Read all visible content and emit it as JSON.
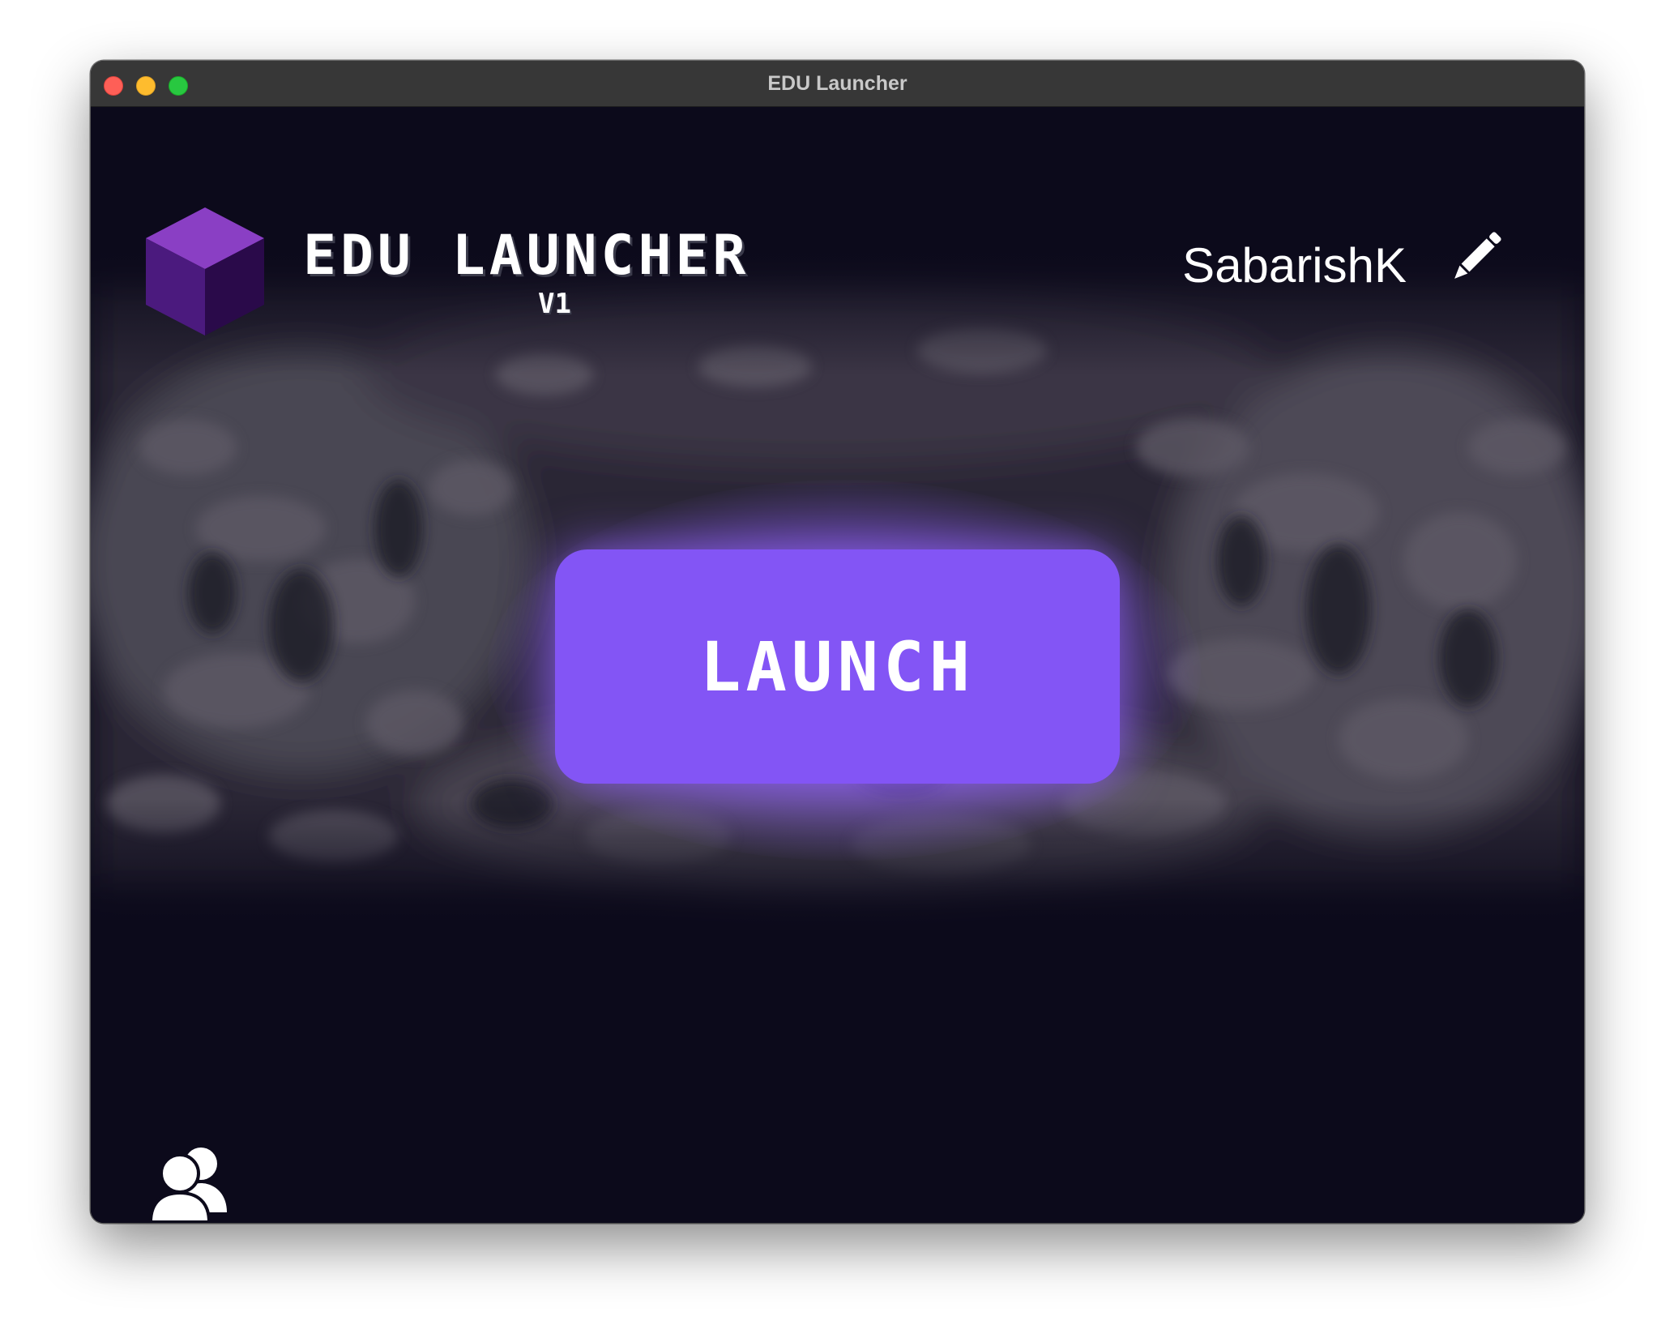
{
  "window": {
    "title": "EDU Launcher"
  },
  "brand": {
    "title": "EDU LAUNCHER",
    "version": "V1",
    "logo_icon": "purple-cube-icon",
    "accent_color": "#8355f5"
  },
  "user": {
    "name": "SabarishK",
    "edit_icon": "pencil-icon"
  },
  "main": {
    "launch_label": "LAUNCH"
  },
  "footer": {
    "friends_icon": "users-icon"
  }
}
